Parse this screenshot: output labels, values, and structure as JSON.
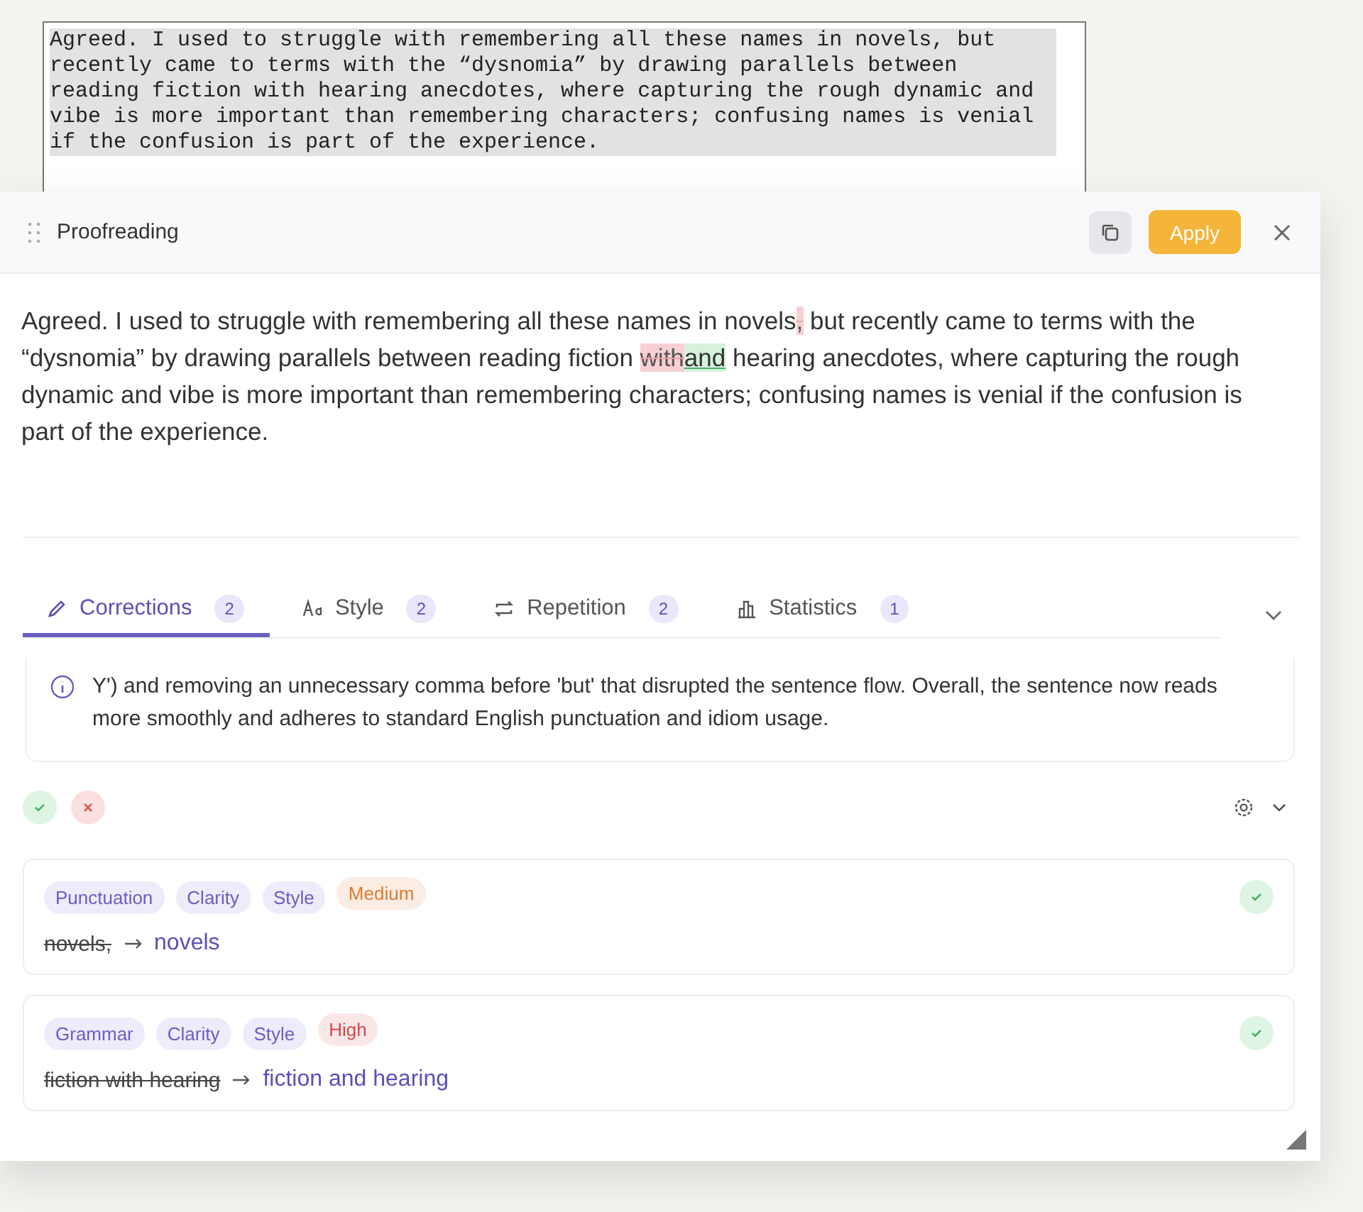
{
  "editor": {
    "text": "Agreed. I used to struggle with remembering all these names in novels, but recently came to terms with the “dysnomia” by drawing parallels between reading fiction with hearing anecdotes, where capturing the rough dynamic and vibe is more important than remembering characters; confusing names is venial if the confusion is part of the experience."
  },
  "panel": {
    "title": "Proofreading",
    "apply": "Apply"
  },
  "preview": [
    {
      "kind": "plain",
      "text": "Agreed. I used to struggle with remembering all these names in novels"
    },
    {
      "kind": "deleted",
      "text": ","
    },
    {
      "kind": "plain",
      "text": " but recently came to terms with the “dysnomia” by drawing parallels between reading fiction "
    },
    {
      "kind": "deleted",
      "text": "with"
    },
    {
      "kind": "inserted",
      "text": "and"
    },
    {
      "kind": "plain",
      "text": " hearing anecdotes, where capturing the rough dynamic and vibe is more important than remembering characters; confusing names is venial if the confusion is part of the experience."
    }
  ],
  "tabs": [
    {
      "label": "Corrections",
      "count": "2",
      "selected": true
    },
    {
      "label": "Style",
      "count": "2",
      "selected": false
    },
    {
      "label": "Repetition",
      "count": "2",
      "selected": false
    },
    {
      "label": "Statistics",
      "count": "1",
      "selected": false
    }
  ],
  "explanation": "Y') and removing an unnecessary comma before 'but' that disrupted the sentence flow. Overall, the sentence now reads more smoothly and adheres to standard English punctuation and idiom usage.",
  "suggestions": [
    {
      "tags": [
        {
          "kind": "category",
          "label": "Punctuation"
        },
        {
          "kind": "category",
          "label": "Clarity"
        },
        {
          "kind": "category",
          "label": "Style"
        },
        {
          "kind": "severity",
          "label": "Medium",
          "color": "#e07a2e"
        }
      ],
      "before": "novels,",
      "after": "novels"
    },
    {
      "tags": [
        {
          "kind": "category",
          "label": "Grammar"
        },
        {
          "kind": "category",
          "label": "Clarity"
        },
        {
          "kind": "category",
          "label": "Style"
        },
        {
          "kind": "severity",
          "label": "High",
          "color": "#d94848"
        }
      ],
      "before": "fiction with hearing",
      "after": "fiction and hearing"
    }
  ]
}
